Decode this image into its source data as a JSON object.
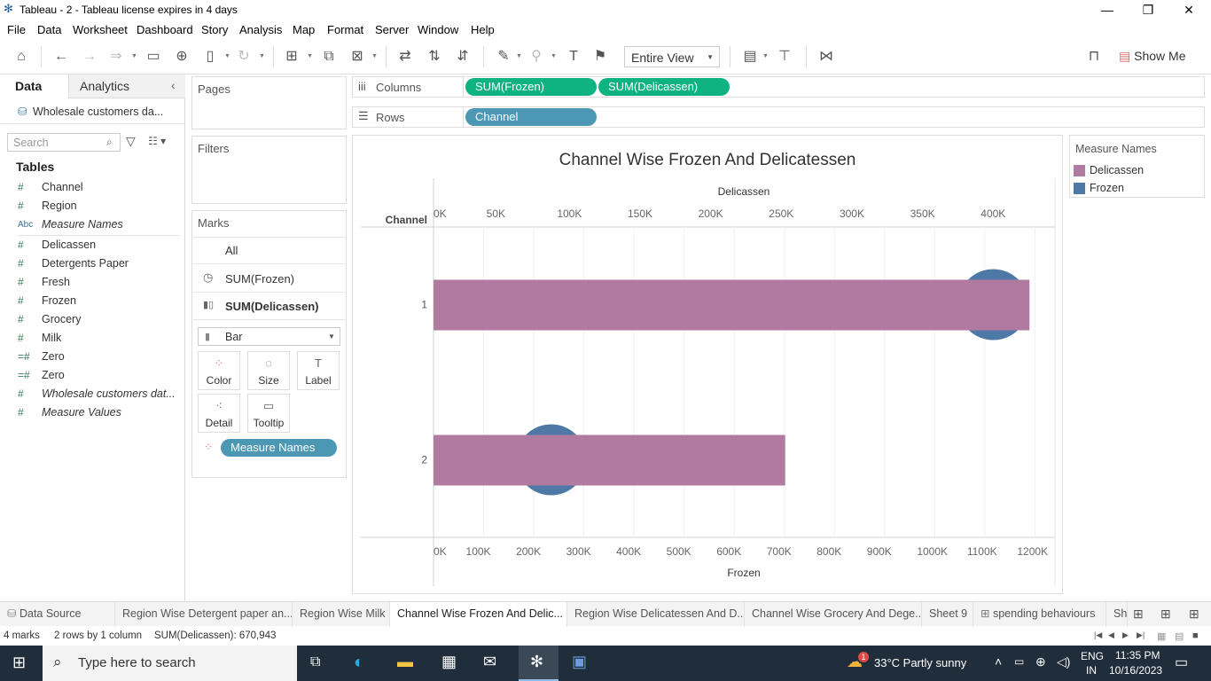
{
  "window": {
    "title": "Tableau - 2 - Tableau license expires in 4 days"
  },
  "menu": [
    "File",
    "Data",
    "Worksheet",
    "Dashboard",
    "Story",
    "Analysis",
    "Map",
    "Format",
    "Server",
    "Window",
    "Help"
  ],
  "toolbar": {
    "fit": "Entire View",
    "show_me": "Show Me"
  },
  "left": {
    "tab_data": "Data",
    "tab_analytics": "Analytics",
    "datasource": "Wholesale customers da...",
    "search_placeholder": "Search",
    "tables_heading": "Tables",
    "fields": [
      {
        "icon": "#",
        "name": "Channel"
      },
      {
        "icon": "#",
        "name": "Region"
      },
      {
        "icon": "Abc",
        "name": "Measure Names"
      },
      {
        "icon": "#",
        "name": "Delicassen"
      },
      {
        "icon": "#",
        "name": "Detergents Paper"
      },
      {
        "icon": "#",
        "name": "Fresh"
      },
      {
        "icon": "#",
        "name": "Frozen"
      },
      {
        "icon": "#",
        "name": "Grocery"
      },
      {
        "icon": "#",
        "name": "Milk"
      },
      {
        "icon": "=#",
        "name": "Zero"
      },
      {
        "icon": "=#",
        "name": "Zero"
      },
      {
        "icon": "#",
        "name": "Wholesale customers dat..."
      },
      {
        "icon": "#",
        "name": "Measure Values"
      }
    ]
  },
  "shelves": {
    "pages": "Pages",
    "filters": "Filters",
    "columns_label": "Columns",
    "rows_label": "Rows",
    "columns": [
      "SUM(Frozen)",
      "SUM(Delicassen)"
    ],
    "rows": [
      "Channel"
    ]
  },
  "marks": {
    "title": "Marks",
    "all": "All",
    "frozen": "SUM(Frozen)",
    "delicassen": "SUM(Delicassen)",
    "mark_type": "Bar",
    "buttons": [
      "Color",
      "Size",
      "Label",
      "Detail",
      "Tooltip"
    ],
    "color_pill": "Measure Names"
  },
  "legend": {
    "title": "Measure Names",
    "items": [
      {
        "name": "Delicassen",
        "color": "#b07aa1"
      },
      {
        "name": "Frozen",
        "color": "#4e79a7"
      }
    ]
  },
  "chart_data": {
    "type": "bar",
    "title": "Channel Wise Frozen And Delicatessen",
    "row_header": "Channel",
    "categories": [
      "1",
      "2"
    ],
    "top_axis": {
      "label": "Delicassen",
      "ticks": [
        "0K",
        "50K",
        "100K",
        "150K",
        "200K",
        "250K",
        "300K",
        "350K",
        "400K"
      ],
      "max": 440000
    },
    "bottom_axis": {
      "label": "Frozen",
      "ticks": [
        "0K",
        "100K",
        "200K",
        "300K",
        "400K",
        "500K",
        "600K",
        "700K",
        "800K",
        "900K",
        "1000K",
        "1100K",
        "1200K"
      ],
      "max": 1240000
    },
    "series": [
      {
        "name": "Delicassen",
        "mark": "bar",
        "values": [
          421955,
          248988
        ],
        "color": "#b07aa1"
      },
      {
        "name": "Frozen",
        "mark": "circle",
        "values": [
          1116979,
          234671
        ],
        "color": "#4e79a7"
      }
    ]
  },
  "sheets": [
    "Data Source",
    "Region Wise Detergent paper an...",
    "Region Wise Milk",
    "Channel Wise Frozen And Delic...",
    "Region Wise Delicatessen And D...",
    "Channel Wise Grocery And Dege...",
    "Sheet 9",
    "spending  behaviours",
    "Sh"
  ],
  "status": {
    "marks": "4 marks",
    "dims": "2 rows by 1 column",
    "sum": "SUM(Delicassen): 670,943"
  },
  "taskbar": {
    "search": "Type here to search",
    "weather": "33°C  Partly sunny",
    "lang": "ENG",
    "region": "IN",
    "time": "11:35 PM",
    "date": "10/16/2023",
    "badge": "1"
  }
}
